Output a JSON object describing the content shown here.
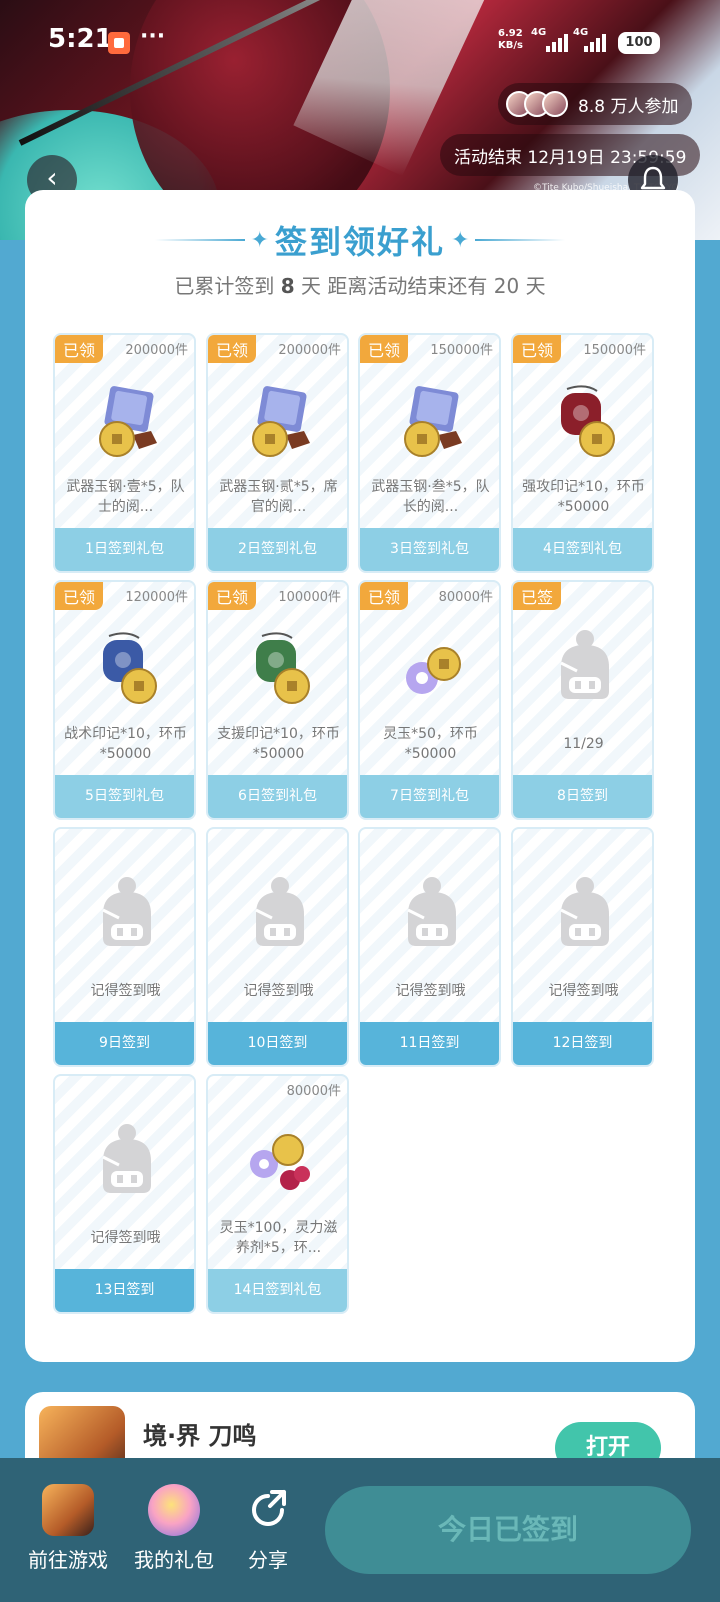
{
  "status_bar": {
    "time": "5:21",
    "net_speed_top": "6.92",
    "net_speed_bottom": "KB/s",
    "network": "4G",
    "network2": "4G",
    "battery": "100"
  },
  "banner": {
    "participants": "8.8 万人参加",
    "end_time": "活动结束 12月19日 23:59:59",
    "copyright": "©Tite Kubo/Shueisha, TV TOKYO"
  },
  "checkin": {
    "title": "签到领好礼",
    "subtitle_prefix": "已累计签到",
    "days_signed": "8",
    "subtitle_mid": "天  距离活动结束还有",
    "days_left": "20",
    "subtitle_suffix": "天"
  },
  "tiles": [
    {
      "badge": "已领",
      "qty": "200000件",
      "desc": "武器玉钢·壹*5，队士的阅...",
      "footer": "1日签到礼包",
      "state": "claimed",
      "icon": "weapon-steel-bundle-icon"
    },
    {
      "badge": "已领",
      "qty": "200000件",
      "desc": "武器玉钢·贰*5，席官的阅...",
      "footer": "2日签到礼包",
      "state": "claimed",
      "icon": "weapon-steel-bundle-icon"
    },
    {
      "badge": "已领",
      "qty": "150000件",
      "desc": "武器玉钢·叁*5，队长的阅...",
      "footer": "3日签到礼包",
      "state": "claimed",
      "icon": "weapon-steel-bundle-icon"
    },
    {
      "badge": "已领",
      "qty": "150000件",
      "desc": "强攻印记*10，环币*50000",
      "footer": "4日签到礼包",
      "state": "claimed",
      "icon": "attack-seal-icon"
    },
    {
      "badge": "已领",
      "qty": "120000件",
      "desc": "战术印记*10，环币*50000",
      "footer": "5日签到礼包",
      "state": "claimed",
      "icon": "tactic-seal-icon"
    },
    {
      "badge": "已领",
      "qty": "100000件",
      "desc": "支援印记*10，环币*50000",
      "footer": "6日签到礼包",
      "state": "claimed",
      "icon": "support-seal-icon"
    },
    {
      "badge": "已领",
      "qty": "80000件",
      "desc": "灵玉*50，环币*50000",
      "footer": "7日签到礼包",
      "state": "claimed",
      "icon": "spirit-jade-coin-icon"
    },
    {
      "badge": "已签",
      "qty": "",
      "desc": "11/29",
      "footer": "8日签到",
      "state": "signed",
      "icon": "mascot-placeholder-icon"
    },
    {
      "badge": "",
      "qty": "",
      "desc": "记得签到哦",
      "footer": "9日签到",
      "state": "future",
      "icon": "mascot-placeholder-icon"
    },
    {
      "badge": "",
      "qty": "",
      "desc": "记得签到哦",
      "footer": "10日签到",
      "state": "future",
      "icon": "mascot-placeholder-icon"
    },
    {
      "badge": "",
      "qty": "",
      "desc": "记得签到哦",
      "footer": "11日签到",
      "state": "future",
      "icon": "mascot-placeholder-icon"
    },
    {
      "badge": "",
      "qty": "",
      "desc": "记得签到哦",
      "footer": "12日签到",
      "state": "future",
      "icon": "mascot-placeholder-icon"
    },
    {
      "badge": "",
      "qty": "",
      "desc": "记得签到哦",
      "footer": "13日签到",
      "state": "future",
      "icon": "mascot-placeholder-icon"
    },
    {
      "badge": "",
      "qty": "80000件",
      "desc": "灵玉*100，灵力滋养剂*5，环...",
      "footer": "14日签到礼包",
      "state": "gift",
      "icon": "spirit-jade-potion-icon"
    }
  ],
  "game": {
    "name": "境·界 刀鸣",
    "open_label": "打开"
  },
  "bottom_bar": {
    "goto_game": "前往游戏",
    "my_gifts": "我的礼包",
    "share": "分享",
    "signed_today": "今日已签到"
  }
}
